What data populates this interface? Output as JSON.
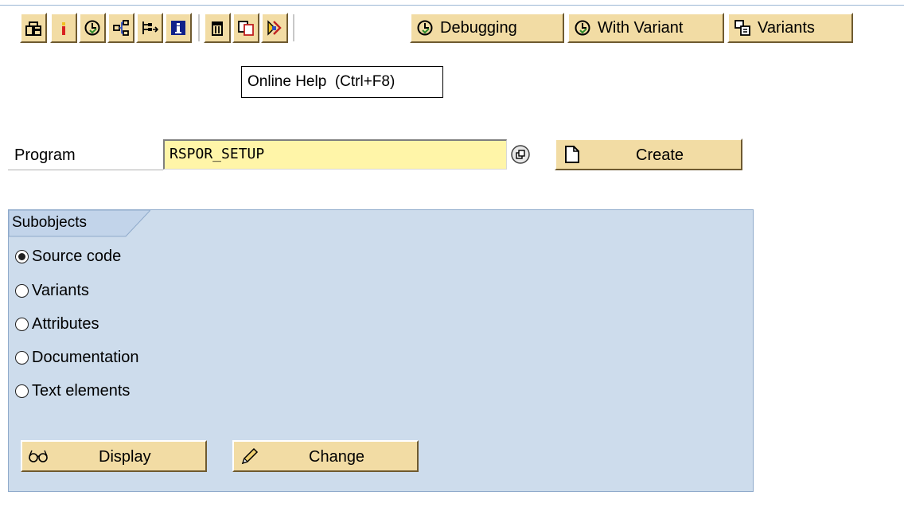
{
  "toolbar": {
    "icon_buttons": [
      {
        "name": "other-object-icon"
      },
      {
        "name": "active-inactive-icon"
      },
      {
        "name": "execute-icon"
      },
      {
        "name": "where-used-list-icon"
      },
      {
        "name": "object-list-icon"
      },
      {
        "name": "info-icon"
      },
      {
        "name": "delete-icon"
      },
      {
        "name": "copy-icon"
      },
      {
        "name": "rename-icon"
      }
    ],
    "debugging_label": "Debugging",
    "with_variant_label": "With Variant",
    "variants_label": "Variants"
  },
  "tooltip": {
    "text": "Online Help  (Ctrl+F8)"
  },
  "program": {
    "label": "Program",
    "value": "RSPOR_SETUP",
    "create_label": "Create"
  },
  "subobjects": {
    "title": "Subobjects",
    "options": [
      {
        "label": "Source code",
        "selected": true
      },
      {
        "label": "Variants",
        "selected": false
      },
      {
        "label": "Attributes",
        "selected": false
      },
      {
        "label": "Documentation",
        "selected": false
      },
      {
        "label": "Text elements",
        "selected": false
      }
    ],
    "display_label": "Display",
    "change_label": "Change"
  },
  "colors": {
    "button_bg": "#f2dca4",
    "input_bg": "#fff5a8",
    "group_bg": "#cddcec",
    "group_border": "#8faacb"
  }
}
